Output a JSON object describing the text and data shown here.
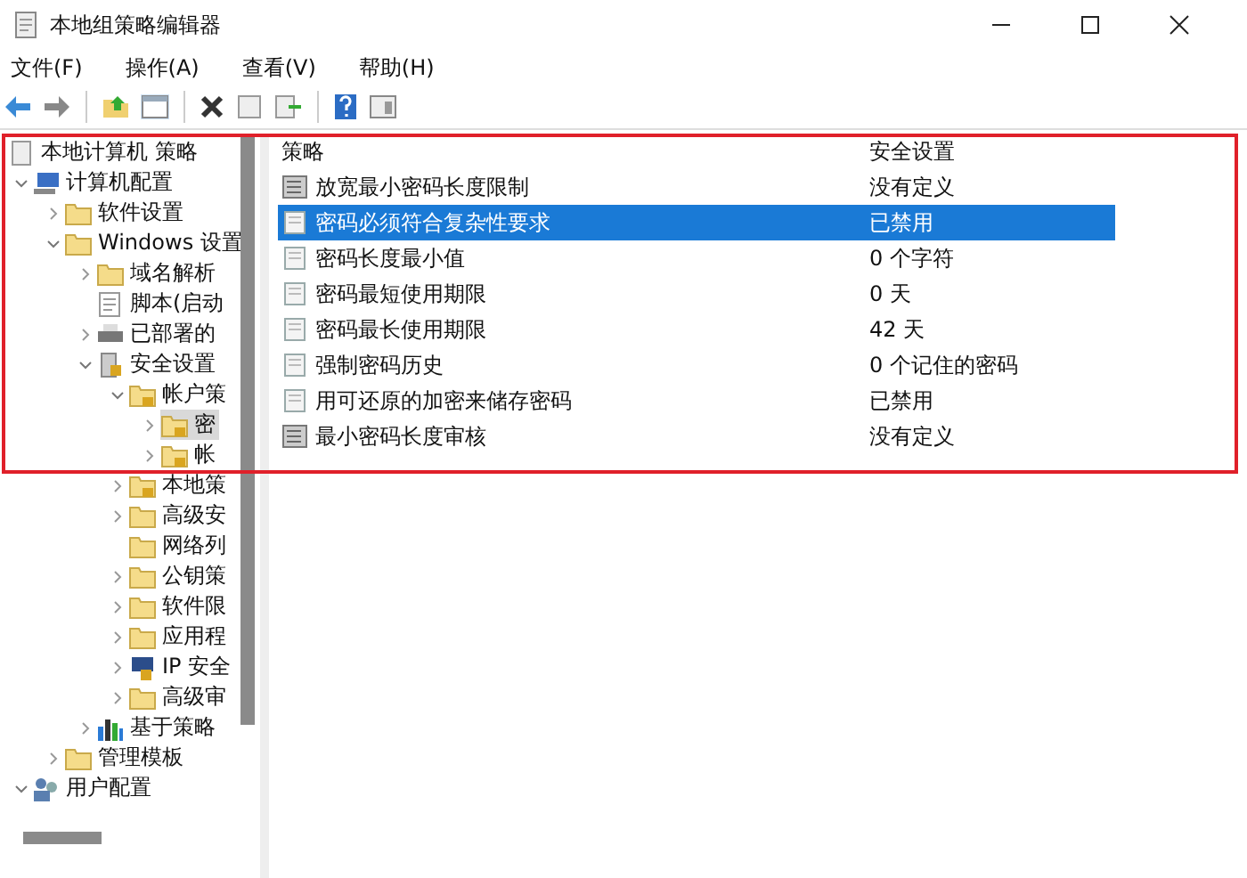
{
  "window": {
    "title": "本地组策略编辑器"
  },
  "menu": [
    "文件(F)",
    "操作(A)",
    "查看(V)",
    "帮助(H)"
  ],
  "tree": [
    {
      "label": "本地计算机 策略",
      "kind": "policy",
      "selected": false,
      "children": [
        {
          "label": "计算机配置",
          "kind": "computer",
          "expanded": true,
          "selected": false,
          "children": [
            {
              "label": "软件设置",
              "kind": "folder",
              "expanded": false,
              "selected": false
            },
            {
              "label": "Windows 设置",
              "kind": "folder",
              "expanded": true,
              "selected": false,
              "children": [
                {
                  "label": "域名解析",
                  "kind": "folder",
                  "expanded": false,
                  "selected": false
                },
                {
                  "label": "脚本(启动",
                  "kind": "script",
                  "selected": false
                },
                {
                  "label": "已部署的",
                  "kind": "printer",
                  "expanded": false,
                  "selected": false
                },
                {
                  "label": "安全设置",
                  "kind": "security",
                  "expanded": true,
                  "selected": false,
                  "children": [
                    {
                      "label": "帐户策",
                      "kind": "lockfolder",
                      "expanded": true,
                      "selected": false,
                      "children": [
                        {
                          "label": "密",
                          "kind": "lockfolder",
                          "expanded": false,
                          "selected": true
                        },
                        {
                          "label": "帐",
                          "kind": "lockfolder",
                          "expanded": false,
                          "selected": false
                        }
                      ]
                    },
                    {
                      "label": "本地策",
                      "kind": "lockfolder",
                      "expanded": false,
                      "selected": false
                    },
                    {
                      "label": "高级安",
                      "kind": "folder",
                      "expanded": false,
                      "selected": false
                    },
                    {
                      "label": "网络列",
                      "kind": "folder",
                      "selected": false
                    },
                    {
                      "label": "公钥策",
                      "kind": "folder",
                      "expanded": false,
                      "selected": false
                    },
                    {
                      "label": "软件限",
                      "kind": "folder",
                      "expanded": false,
                      "selected": false
                    },
                    {
                      "label": "应用程",
                      "kind": "folder",
                      "expanded": false,
                      "selected": false
                    },
                    {
                      "label": "IP 安全",
                      "kind": "ipsec",
                      "expanded": false,
                      "selected": false
                    },
                    {
                      "label": "高级审",
                      "kind": "folder",
                      "expanded": false,
                      "selected": false
                    }
                  ]
                },
                {
                  "label": "基于策略",
                  "kind": "chart",
                  "expanded": false,
                  "selected": false
                }
              ]
            },
            {
              "label": "管理模板",
              "kind": "folder",
              "expanded": false,
              "selected": false
            }
          ]
        },
        {
          "label": "用户配置",
          "kind": "users",
          "expanded": true,
          "selected": false
        }
      ]
    }
  ],
  "table": {
    "columns": [
      "策略",
      "安全设置"
    ],
    "rows": [
      {
        "kind": "box",
        "policy": "放宽最小密码长度限制",
        "setting": "没有定义",
        "selected": false
      },
      {
        "kind": "doc",
        "policy": "密码必须符合复杂性要求",
        "setting": "已禁用",
        "selected": true
      },
      {
        "kind": "doc",
        "policy": "密码长度最小值",
        "setting": "0 个字符",
        "selected": false
      },
      {
        "kind": "doc",
        "policy": "密码最短使用期限",
        "setting": "0 天",
        "selected": false
      },
      {
        "kind": "doc",
        "policy": "密码最长使用期限",
        "setting": "42 天",
        "selected": false
      },
      {
        "kind": "doc",
        "policy": "强制密码历史",
        "setting": "0 个记住的密码",
        "selected": false
      },
      {
        "kind": "doc",
        "policy": "用可还原的加密来储存密码",
        "setting": "已禁用",
        "selected": false
      },
      {
        "kind": "box",
        "policy": "最小密码长度审核",
        "setting": "没有定义",
        "selected": false
      }
    ]
  }
}
